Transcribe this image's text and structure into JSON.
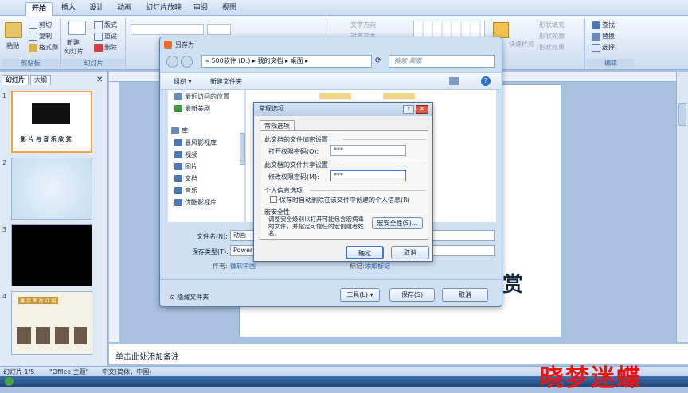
{
  "ribbon": {
    "tabs": [
      "开始",
      "插入",
      "设计",
      "动画",
      "幻灯片放映",
      "审阅",
      "视图"
    ],
    "clipboard": {
      "paste": "粘贴",
      "cut": "剪切",
      "copy": "复制",
      "format_painter": "格式刷",
      "group_label": "剪贴板"
    },
    "slides": {
      "new_slide": "新建",
      "new_slide2": "幻灯片",
      "layout": "版式",
      "reset": "重设",
      "delete": "删除",
      "group_label": "幻灯片"
    },
    "paragraph": {
      "text_direction": "文字方向",
      "align_text": "对齐文本"
    },
    "drawing": {
      "quick_styles": "快速样式",
      "shape_fill": "形状填充",
      "shape_outline": "形状轮廓",
      "shape_effects": "形状效果"
    },
    "editing": {
      "find": "查找",
      "replace": "替换",
      "select": "选择",
      "group_label": "编辑"
    }
  },
  "slides_panel": {
    "tab_slides": "幻灯片",
    "tab_outline": "大纲",
    "numbers": [
      "1",
      "2",
      "3",
      "4"
    ],
    "slide1_title": "影 片 与 音 乐 欣 赏",
    "slide4_title": "演 示 图 片 介 绍"
  },
  "main_slide": {
    "partial_title": "赏",
    "thumb_label": "动画"
  },
  "save_as": {
    "title": "另存为",
    "path": [
      "500软件 (D:)",
      "我的文档",
      "桌面"
    ],
    "path_prefix": "«",
    "search_placeholder": "搜索 桌面",
    "organize": "组织",
    "new_folder": "新建文件夹",
    "nav_items": [
      "最近访问的位置",
      "最新美剧",
      "库",
      "暴风影视库",
      "视频",
      "图片",
      "文档",
      "音乐",
      "优酷影视库"
    ],
    "filename_label": "文件名(N):",
    "filename_value": "动画",
    "savetype_label": "保存类型(T):",
    "savetype_value": "PowerP",
    "author_label": "作者:",
    "author_value": "微软中国",
    "tags_label": "标记:",
    "tags_value": "添加标记",
    "hide_folders": "隐藏文件夹",
    "tools": "工具(L)",
    "save": "保存(S)",
    "cancel": "取消"
  },
  "general_options": {
    "title": "常规选项",
    "tab": "常规选项",
    "encrypt_section": "此文档的文件加密设置",
    "open_pwd_label": "打开权限密码(O):",
    "open_pwd_value": "***",
    "share_section": "此文档的文件共享设置",
    "modify_pwd_label": "修改权限密码(M):",
    "modify_pwd_value": "***",
    "privacy_section": "个人信息选项",
    "privacy_checkbox": "保存时自动删除在该文件中创建的个人信息(R)",
    "macro_section": "宏安全性",
    "macro_text": "调整安全级别以打开可能包含宏病毒的文件，并指定可信任的宏创建者姓名。",
    "macro_button": "宏安全性(S)...",
    "ok": "确定",
    "cancel": "取消"
  },
  "notes": {
    "placeholder": "单击此处添加备注"
  },
  "status": {
    "slide": "幻灯片 1/5",
    "theme": "\"Office 主题\"",
    "lang": "中文(简体，中国)"
  },
  "watermark": "晓梦迷蝶",
  "colors": {
    "accent": "#4a78b4",
    "status_bg": "#c3d6ee",
    "watermark": "#ee1111"
  }
}
